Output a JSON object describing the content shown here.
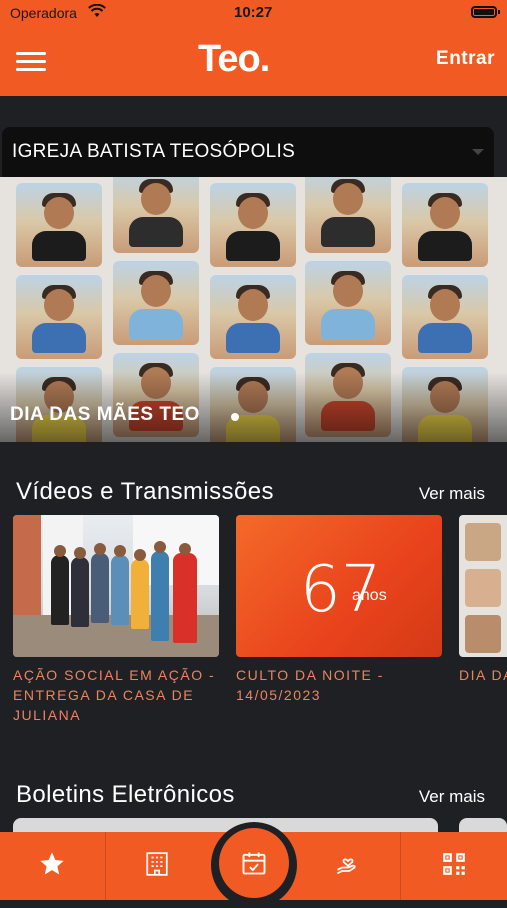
{
  "status_bar": {
    "carrier": "Operadora",
    "time": "10:27"
  },
  "header": {
    "logo": "Teo.",
    "login_label": "Entrar",
    "menu_icon": "hamburger-icon"
  },
  "church_selector": {
    "value": "IGREJA BATISTA TEOSÓPOLIS"
  },
  "banner": {
    "caption": "DIA DAS MÃES TEO"
  },
  "videos": {
    "title": "Vídeos e Transmissões",
    "see_more": "Ver mais",
    "items": [
      {
        "title": "AÇÃO SOCIAL EM AÇÃO - ENTREGA DA CASA DE JULIANA"
      },
      {
        "title": "CULTO DA NOITE - 14/05/2023",
        "thumb_text_number": "67",
        "thumb_text_word": "anos"
      },
      {
        "title": "DIA DA"
      }
    ]
  },
  "bulletins": {
    "title": "Boletins Eletrônicos",
    "see_more": "Ver mais"
  },
  "tab_bar": {
    "items": [
      {
        "icon": "star-icon"
      },
      {
        "icon": "building-icon"
      },
      {
        "icon": "calendar-check-icon"
      },
      {
        "icon": "giving-hand-icon"
      },
      {
        "icon": "qr-code-icon"
      }
    ]
  },
  "colors": {
    "brand": "#f15a22",
    "background": "#1f2023",
    "card_title": "#e9855f"
  }
}
